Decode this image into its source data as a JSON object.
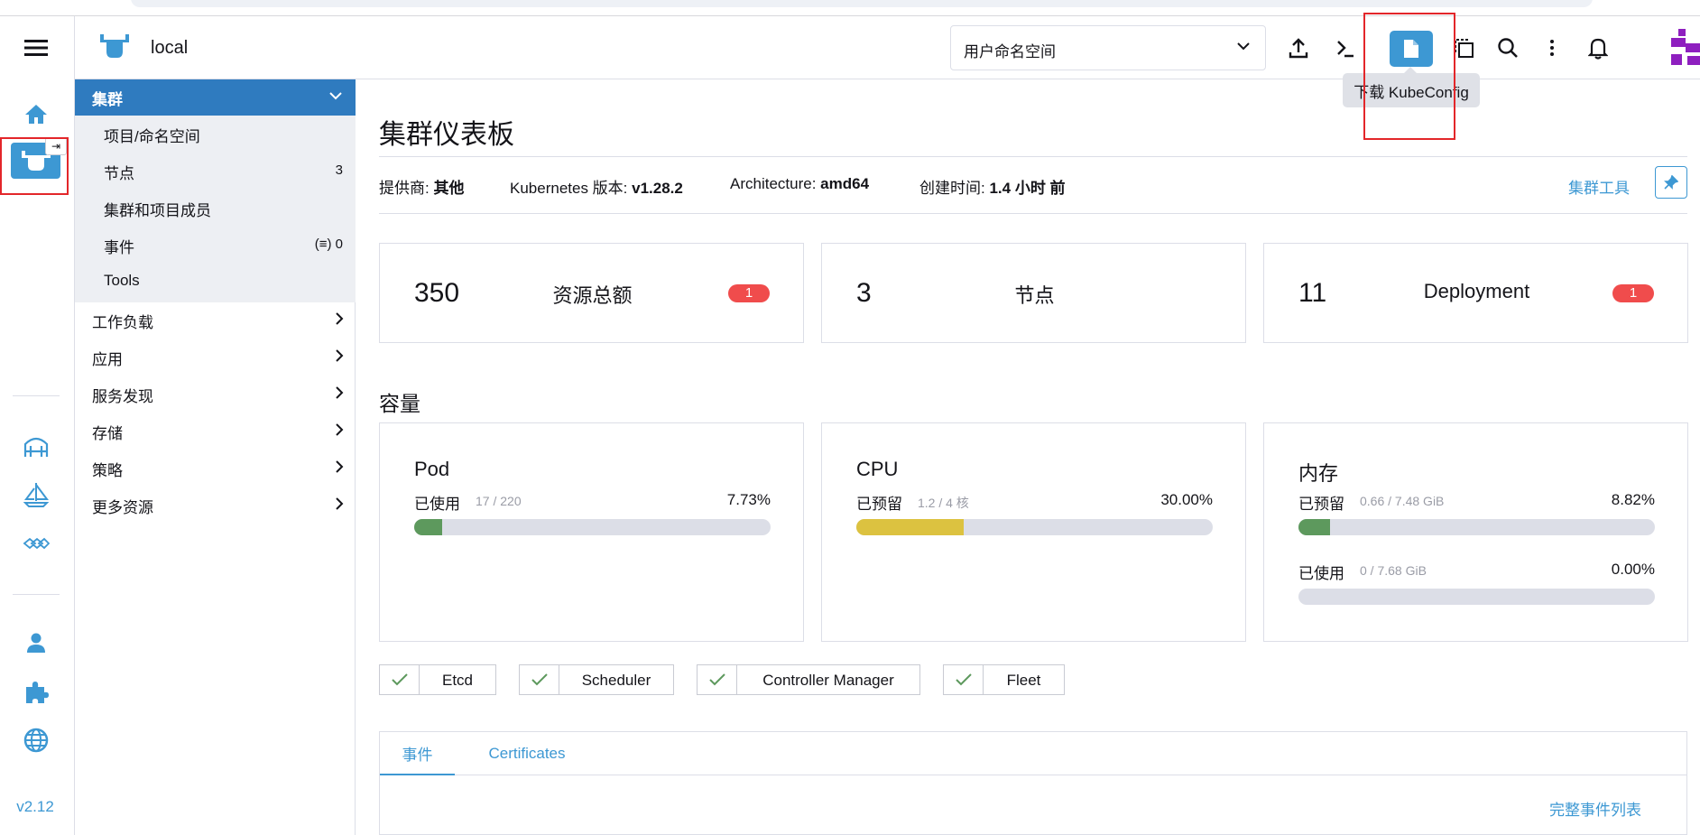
{
  "header": {
    "cluster_name": "local",
    "namespace_select": "用户命名空间",
    "tooltip": "下载 KubeConfig"
  },
  "rail": {
    "version": "v2.12"
  },
  "sidenav": {
    "group": "集群",
    "sub_items": [
      {
        "label": "项目/命名空间",
        "count": ""
      },
      {
        "label": "节点",
        "count": "3"
      },
      {
        "label": "集群和项目成员",
        "count": ""
      },
      {
        "label": "事件",
        "count": "(≡) 0"
      },
      {
        "label": "Tools",
        "count": ""
      }
    ],
    "top_items": [
      "工作负载",
      "应用",
      "服务发现",
      "存储",
      "策略",
      "更多资源"
    ]
  },
  "main": {
    "title": "集群仪表板",
    "meta": {
      "provider_label": "提供商:",
      "provider": "其他",
      "k8s_label": "Kubernetes 版本:",
      "k8s": "v1.28.2",
      "arch_label": "Architecture:",
      "arch": "amd64",
      "created_label": "创建时间:",
      "created": "1.4 小时 前"
    },
    "tools_link": "集群工具",
    "stats": [
      {
        "num": "350",
        "label": "资源总额",
        "badge": "1"
      },
      {
        "num": "3",
        "label": "节点",
        "badge": ""
      },
      {
        "num": "11",
        "label": "Deployment",
        "badge": "1"
      }
    ],
    "capacity_title": "容量",
    "capacity": [
      {
        "title": "Pod",
        "rows": [
          {
            "label": "已使用",
            "sub": "17 / 220",
            "pct": "7.73%",
            "value": 0.0773,
            "color": "#5d995d"
          }
        ]
      },
      {
        "title": "CPU",
        "rows": [
          {
            "label": "已预留",
            "sub": "1.2 / 4 核",
            "pct": "30.00%",
            "value": 0.3,
            "color": "#dcc240"
          }
        ]
      },
      {
        "title": "内存",
        "rows": [
          {
            "label": "已预留",
            "sub": "0.66 / 7.48 GiB",
            "pct": "8.82%",
            "value": 0.0882,
            "color": "#5d995d"
          },
          {
            "label": "已使用",
            "sub": "0 / 7.68 GiB",
            "pct": "0.00%",
            "value": 0.0,
            "color": "#5d995d"
          }
        ]
      }
    ],
    "components": [
      "Etcd",
      "Scheduler",
      "Controller Manager",
      "Fleet"
    ],
    "tabs": [
      "事件",
      "Certificates"
    ],
    "full_events_link": "完整事件列表"
  }
}
